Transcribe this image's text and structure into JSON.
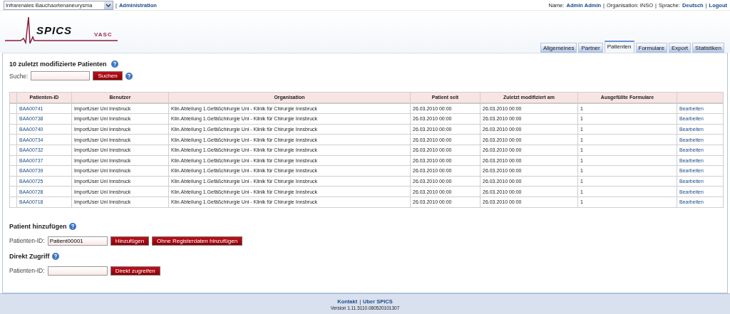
{
  "topbar": {
    "study_select": {
      "value": "Infrarenales Bauchaortenaneurysma"
    },
    "left_links": [
      {
        "kind": "sep",
        "text": "|"
      },
      {
        "kind": "link",
        "text": "Administration"
      }
    ],
    "user_info": [
      {
        "kind": "text",
        "text": "Name:"
      },
      {
        "kind": "link",
        "text": "Admin Admin"
      },
      {
        "kind": "sep",
        "text": "|"
      },
      {
        "kind": "text",
        "text": "Organisation: INSO"
      },
      {
        "kind": "sep",
        "text": "|"
      },
      {
        "kind": "text",
        "text": "Sprache:"
      },
      {
        "kind": "link",
        "text": "Deutsch"
      },
      {
        "kind": "sep",
        "text": "|"
      },
      {
        "kind": "link",
        "text": "Logout"
      }
    ]
  },
  "logo": {
    "title": "SPICS",
    "subtitle": "VASC"
  },
  "tabs": [
    {
      "label": "Allgemeines",
      "selected": false
    },
    {
      "label": "Partner",
      "selected": false
    },
    {
      "label": "Patienten",
      "selected": true
    },
    {
      "label": "Formulare",
      "selected": false
    },
    {
      "label": "Export",
      "selected": false
    },
    {
      "label": "Statistiken",
      "selected": false
    }
  ],
  "recent": {
    "title": "10 zuletzt modifizierte Patienten",
    "search_label": "Suche:",
    "search_button": "Suchen"
  },
  "table": {
    "columns": [
      "Patienten-ID",
      "Benutzer",
      "Organisation",
      "Patient seit",
      "Zuletzt modifiziert am",
      "Ausgefüllte Formulare"
    ],
    "rows": [
      {
        "id": "BAA00741",
        "user": "ImportUser Uni Innsbruck",
        "org": "Klin.Abteilung 1.Gefäßchirurgie Uni - Klinik für Chirurgie Innsbruck",
        "since": "26.03.2010 00:00",
        "modified": "26.03.2010 00:00",
        "forms": "1",
        "action": "Bearbeiten"
      },
      {
        "id": "BAA00738",
        "user": "ImportUser Uni Innsbruck",
        "org": "Klin.Abteilung 1.Gefäßchirurgie Uni - Klinik für Chirurgie Innsbruck",
        "since": "26.03.2010 00:00",
        "modified": "26.03.2010 00:00",
        "forms": "1",
        "action": "Bearbeiten"
      },
      {
        "id": "BAA00740",
        "user": "ImportUser Uni Innsbruck",
        "org": "Klin.Abteilung 1.Gefäßchirurgie Uni - Klinik für Chirurgie Innsbruck",
        "since": "26.03.2010 00:00",
        "modified": "26.03.2010 00:00",
        "forms": "1",
        "action": "Bearbeiten"
      },
      {
        "id": "BAA00734",
        "user": "ImportUser Uni Innsbruck",
        "org": "Klin.Abteilung 1.Gefäßchirurgie Uni - Klinik für Chirurgie Innsbruck",
        "since": "26.03.2010 00:00",
        "modified": "26.03.2010 00:00",
        "forms": "1",
        "action": "Bearbeiten"
      },
      {
        "id": "BAA00732",
        "user": "ImportUser Uni Innsbruck",
        "org": "Klin.Abteilung 1.Gefäßchirurgie Uni - Klinik für Chirurgie Innsbruck",
        "since": "26.03.2010 00:00",
        "modified": "26.03.2010 00:00",
        "forms": "1",
        "action": "Bearbeiten"
      },
      {
        "id": "BAA00737",
        "user": "ImportUser Uni Innsbruck",
        "org": "Klin.Abteilung 1.Gefäßchirurgie Uni - Klinik für Chirurgie Innsbruck",
        "since": "26.03.2010 00:00",
        "modified": "26.03.2010 00:00",
        "forms": "1",
        "action": "Bearbeiten"
      },
      {
        "id": "BAA00739",
        "user": "ImportUser Uni Innsbruck",
        "org": "Klin.Abteilung 1.Gefäßchirurgie Uni - Klinik für Chirurgie Innsbruck",
        "since": "26.03.2010 00:00",
        "modified": "26.03.2010 00:00",
        "forms": "1",
        "action": "Bearbeiten"
      },
      {
        "id": "BAA00725",
        "user": "ImportUser Uni Innsbruck",
        "org": "Klin.Abteilung 1.Gefäßchirurgie Uni - Klinik für Chirurgie Innsbruck",
        "since": "26.03.2010 00:00",
        "modified": "26.03.2010 00:00",
        "forms": "1",
        "action": "Bearbeiten"
      },
      {
        "id": "BAA00728",
        "user": "ImportUser Uni Innsbruck",
        "org": "Klin.Abteilung 1.Gefäßchirurgie Uni - Klinik für Chirurgie Innsbruck",
        "since": "26.03.2010 00:00",
        "modified": "26.03.2010 00:00",
        "forms": "1",
        "action": "Bearbeiten"
      },
      {
        "id": "BAA00718",
        "user": "ImportUser Uni Innsbruck",
        "org": "Klin.Abteilung 1.Gefäßchirurgie Uni - Klinik für Chirurgie Innsbruck",
        "since": "26.03.2010 00:00",
        "modified": "26.03.2010 00:00",
        "forms": "1",
        "action": "Bearbeiten"
      }
    ]
  },
  "add_patient": {
    "title": "Patient hinzufügen",
    "id_label": "Patienten-ID:",
    "id_value": "Patient00001",
    "buttons": [
      "Hinzufügen",
      "Ohne Registerdaten hinzufügen"
    ]
  },
  "direct_access": {
    "title": "Direkt Zugriff",
    "id_label": "Patienten-ID:",
    "buttons": [
      "Direkt zugreifen"
    ]
  },
  "footer": {
    "links": [
      {
        "kind": "link",
        "text": "Kontakt"
      },
      {
        "kind": "sep",
        "text": "|"
      },
      {
        "kind": "link",
        "text": "Uber SPICS"
      }
    ],
    "version": "Version 1.11.5110.080520101307"
  }
}
